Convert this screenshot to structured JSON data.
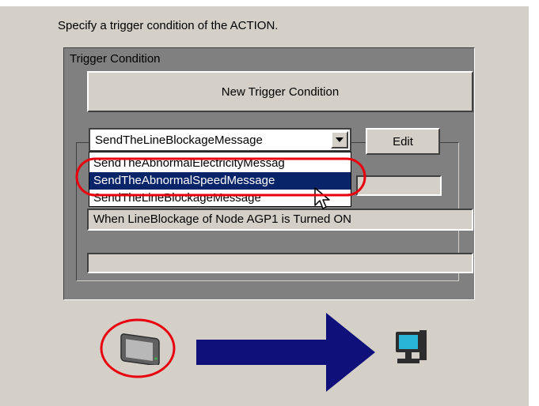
{
  "instruction": "Specify a trigger condition of the ACTION.",
  "trigger_group": {
    "title": "Trigger Condition",
    "new_button_label": "New Trigger Condition",
    "combo_value": "SendTheLineBlockageMessage",
    "edit_button_label": "Edit",
    "dropdown_options": [
      "SendTheAbnormalElectricityMessag",
      "SendTheAbnormalSpeedMessage",
      "SendTheLineBlockageMessage"
    ],
    "selected_option": "SendTheAbnormalSpeedMessage",
    "condition_text": "When LineBlockage of Node AGP1 is Turned ON",
    "empty_field_value": ""
  },
  "colors": {
    "highlight_circle": "#e8000f",
    "arrow": "#10107a",
    "selection": "#0a246a",
    "panel": "#808080",
    "face": "#d4d0c8"
  },
  "icons": {
    "source": "display-device-icon",
    "target": "pc-monitor-icon",
    "flow": "right-arrow-icon"
  }
}
